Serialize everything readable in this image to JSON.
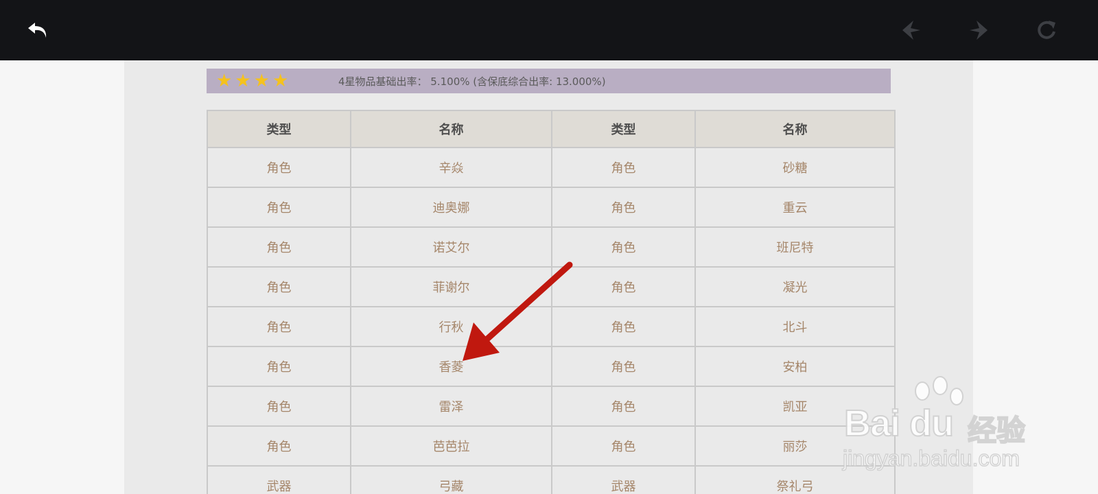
{
  "toolbar": {
    "back_icon": "undo-arrow-icon",
    "prev_icon": "nav-prev-icon",
    "next_icon": "nav-next-icon",
    "refresh_icon": "refresh-icon"
  },
  "rate": {
    "stars": 4,
    "text": "4星物品基础出率： 5.100% (含保底综合出率: 13.000%)"
  },
  "table": {
    "headers": [
      "类型",
      "名称",
      "类型",
      "名称"
    ],
    "rows": [
      [
        "角色",
        "辛焱",
        "角色",
        "砂糖"
      ],
      [
        "角色",
        "迪奥娜",
        "角色",
        "重云"
      ],
      [
        "角色",
        "诺艾尔",
        "角色",
        "班尼特"
      ],
      [
        "角色",
        "菲谢尔",
        "角色",
        "凝光"
      ],
      [
        "角色",
        "行秋",
        "角色",
        "北斗"
      ],
      [
        "角色",
        "香菱",
        "角色",
        "安柏"
      ],
      [
        "角色",
        "雷泽",
        "角色",
        "凯亚"
      ],
      [
        "角色",
        "芭芭拉",
        "角色",
        "丽莎"
      ],
      [
        "武器",
        "弓藏",
        "武器",
        "祭礼弓"
      ]
    ]
  },
  "watermark": {
    "logo": "Bai du",
    "brand": "经验",
    "url": "jingyan.baidu.com"
  },
  "colors": {
    "topbar": "#131417",
    "rate_bar": "#b9aec3",
    "star": "#f5c21d",
    "cell_text": "#a5866a",
    "arrow": "#c0180f"
  }
}
